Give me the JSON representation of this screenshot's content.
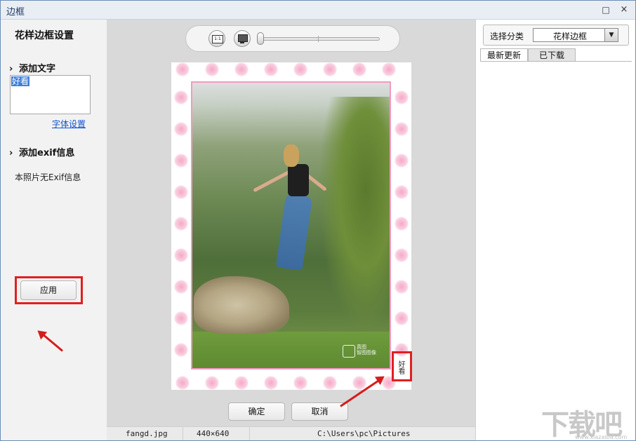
{
  "window": {
    "title": "边框",
    "maximize_icon": "□",
    "close_icon": "×"
  },
  "left_panel": {
    "title": "花样边框设置",
    "add_text_section": "添加文字",
    "text_value": "好看",
    "font_settings_link": "字体设置",
    "add_exif_section": "添加exif信息",
    "exif_message": "本照片无Exif信息",
    "apply_button": "应用"
  },
  "toolbar": {
    "actual_size_label": "1:1",
    "zoom_level_fraction": 0.0
  },
  "preview": {
    "watermark_line1": "真图",
    "watermark_line2": "智图图像",
    "vertical_text": "好看",
    "ok_button": "确定",
    "cancel_button": "取消"
  },
  "statusbar": {
    "filename": "fangd.jpg",
    "dimensions": "440×640",
    "path": "C:\\Users\\pc\\Pictures"
  },
  "right_panel": {
    "category_label": "选择分类",
    "category_value": "花样边框",
    "tabs": [
      {
        "label": "最新更新",
        "active": true
      },
      {
        "label": "已下载",
        "active": false
      }
    ]
  },
  "site_logo": {
    "text": "下载吧",
    "url": "www.xiazaiba.com"
  },
  "colors": {
    "highlight": "#e02020",
    "heart": "#f5a9c7",
    "frame_border": "#f39ac0"
  }
}
